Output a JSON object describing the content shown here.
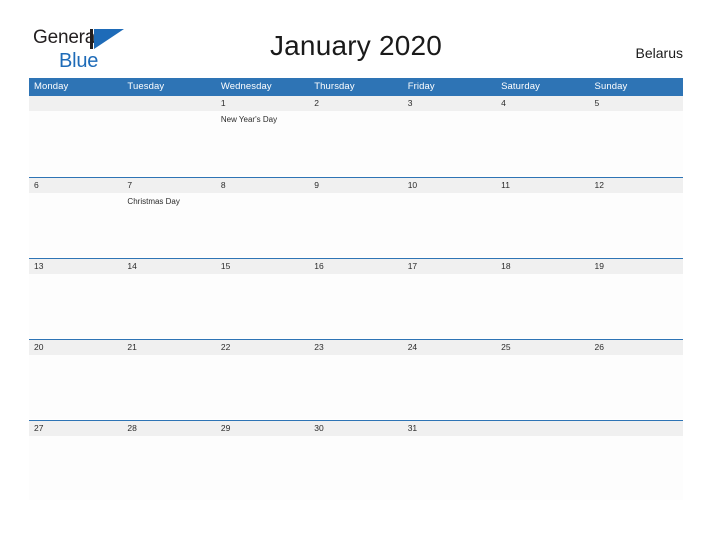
{
  "brand": {
    "word1": "General",
    "word2": "Blue",
    "mark": "triangle-logo"
  },
  "header": {
    "title": "January 2020",
    "country": "Belarus"
  },
  "calendar": {
    "weekdays": [
      "Monday",
      "Tuesday",
      "Wednesday",
      "Thursday",
      "Friday",
      "Saturday",
      "Sunday"
    ],
    "accent_color": "#2e74b5",
    "daynum_band_color": "#f0f0f0",
    "weeks": [
      [
        {
          "day": "",
          "event": ""
        },
        {
          "day": "",
          "event": ""
        },
        {
          "day": "1",
          "event": "New Year's Day"
        },
        {
          "day": "2",
          "event": ""
        },
        {
          "day": "3",
          "event": ""
        },
        {
          "day": "4",
          "event": ""
        },
        {
          "day": "5",
          "event": ""
        }
      ],
      [
        {
          "day": "6",
          "event": ""
        },
        {
          "day": "7",
          "event": "Christmas Day"
        },
        {
          "day": "8",
          "event": ""
        },
        {
          "day": "9",
          "event": ""
        },
        {
          "day": "10",
          "event": ""
        },
        {
          "day": "11",
          "event": ""
        },
        {
          "day": "12",
          "event": ""
        }
      ],
      [
        {
          "day": "13",
          "event": ""
        },
        {
          "day": "14",
          "event": ""
        },
        {
          "day": "15",
          "event": ""
        },
        {
          "day": "16",
          "event": ""
        },
        {
          "day": "17",
          "event": ""
        },
        {
          "day": "18",
          "event": ""
        },
        {
          "day": "19",
          "event": ""
        }
      ],
      [
        {
          "day": "20",
          "event": ""
        },
        {
          "day": "21",
          "event": ""
        },
        {
          "day": "22",
          "event": ""
        },
        {
          "day": "23",
          "event": ""
        },
        {
          "day": "24",
          "event": ""
        },
        {
          "day": "25",
          "event": ""
        },
        {
          "day": "26",
          "event": ""
        }
      ],
      [
        {
          "day": "27",
          "event": ""
        },
        {
          "day": "28",
          "event": ""
        },
        {
          "day": "29",
          "event": ""
        },
        {
          "day": "30",
          "event": ""
        },
        {
          "day": "31",
          "event": ""
        },
        {
          "day": "",
          "event": ""
        },
        {
          "day": "",
          "event": ""
        }
      ]
    ]
  }
}
